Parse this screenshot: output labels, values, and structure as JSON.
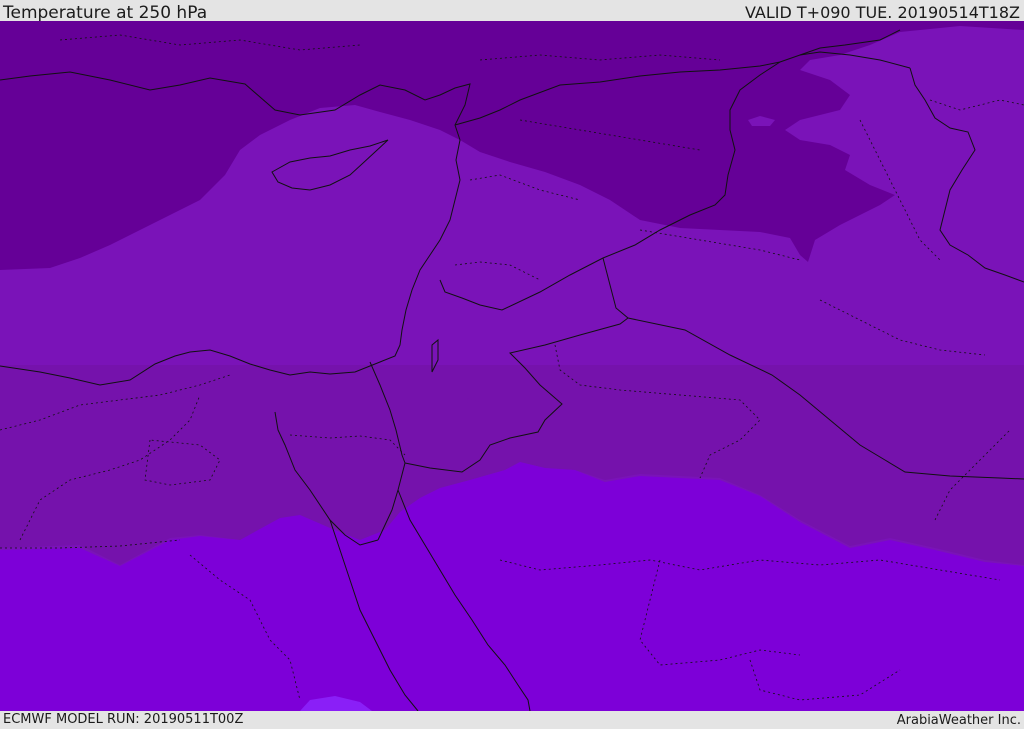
{
  "header": {
    "title": "Temperature at 250 hPa",
    "valid_time": "VALID T+090 TUE. 20190514T18Z"
  },
  "footer": {
    "model_run": "ECMWF MODEL RUN: 20190511T00Z",
    "credit": "ArabiaWeather Inc."
  },
  "map": {
    "field": "temperature",
    "level": "250 hPa",
    "fill_colors": {
      "coldest": "#650097",
      "cold": "#7a13b8",
      "medium": "#7512ac",
      "warm": "#7d00d8",
      "warmest": "#8a1ff7"
    },
    "border_color": "#111111"
  }
}
